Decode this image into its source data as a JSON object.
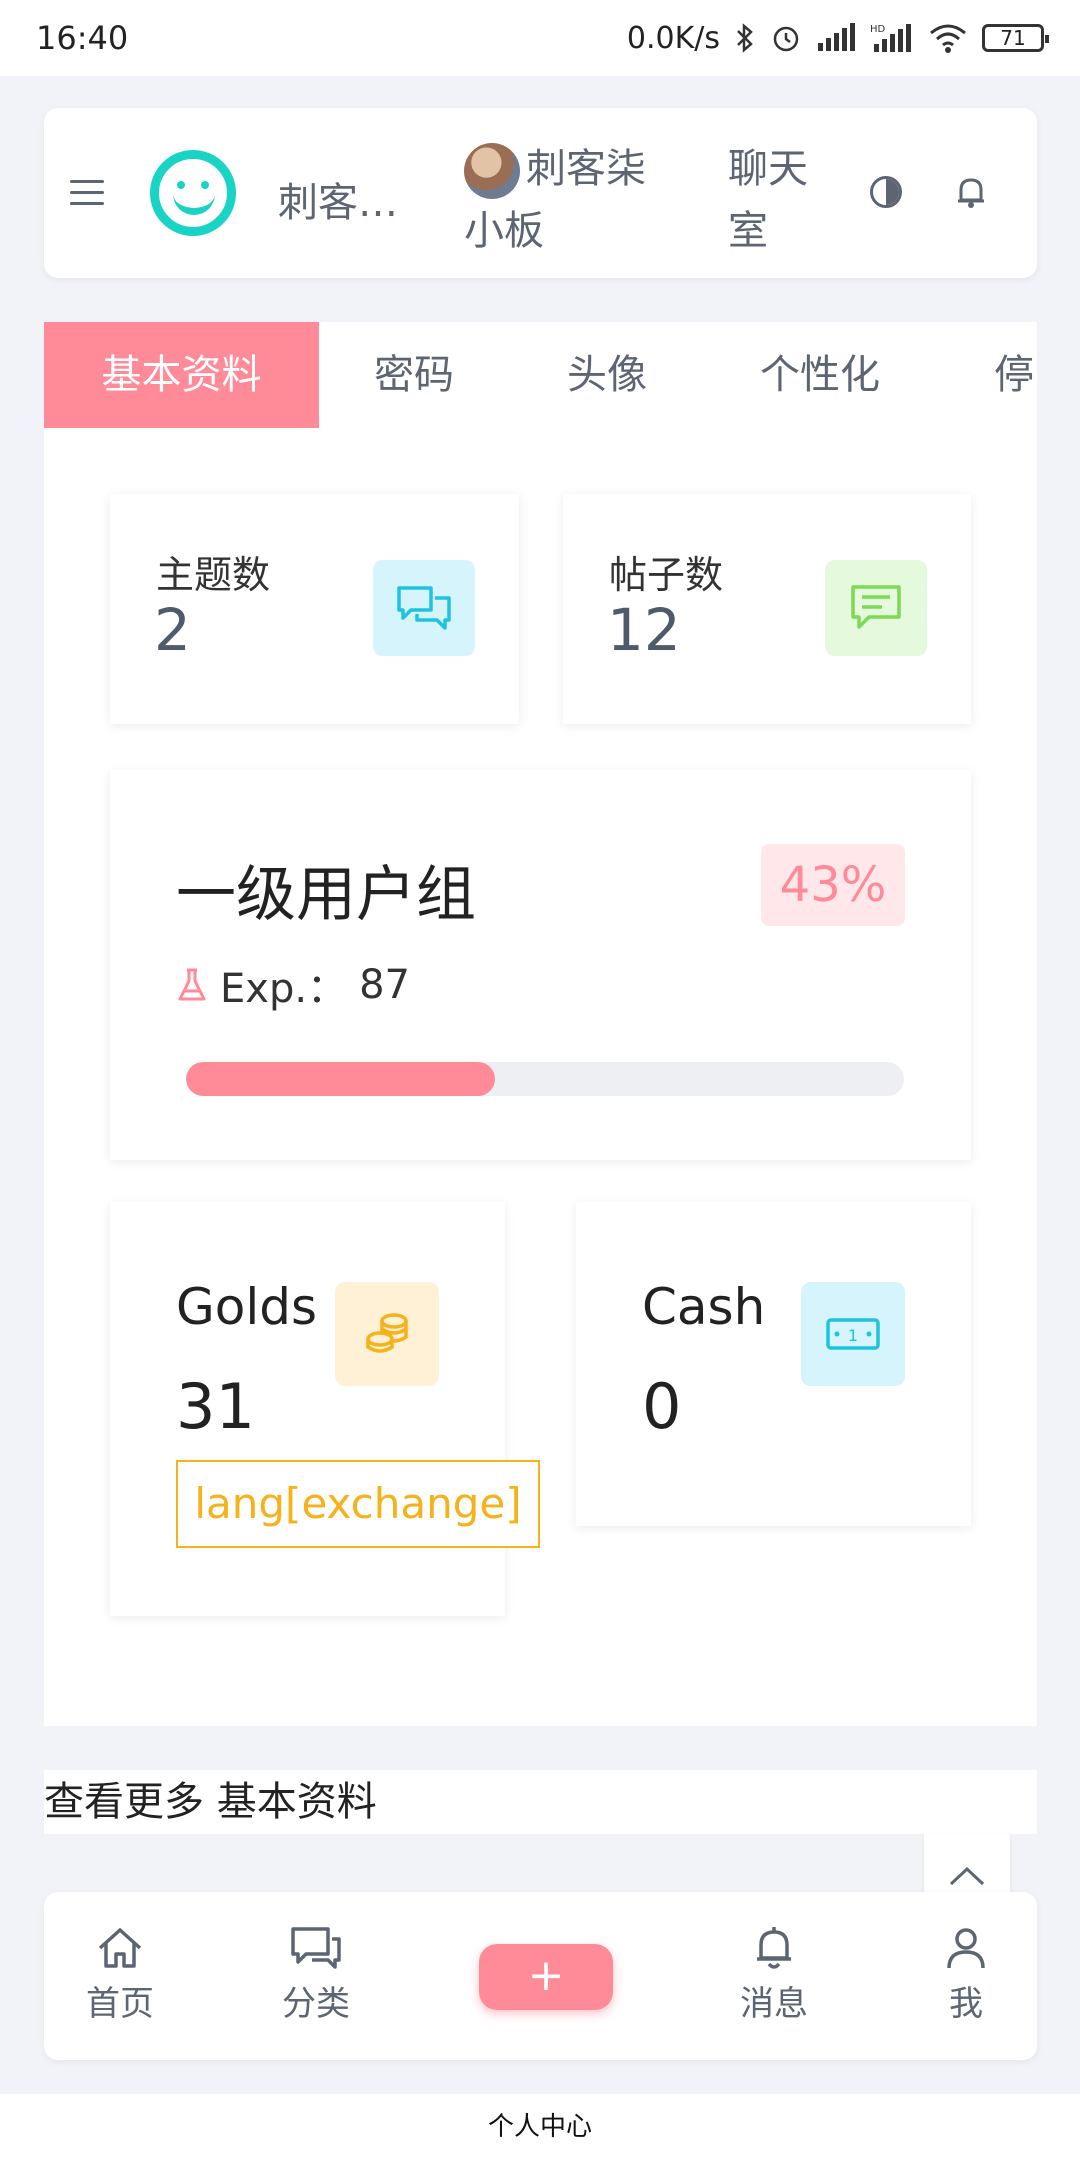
{
  "status_bar": {
    "time": "16:40",
    "speed": "0.0K/s",
    "battery": "71"
  },
  "header": {
    "site_title": "刺客…",
    "user_name": "刺客柒小板",
    "chat_label": "聊天室"
  },
  "tabs": [
    {
      "label": "基本资料",
      "active": true
    },
    {
      "label": "密码",
      "active": false
    },
    {
      "label": "头像",
      "active": false
    },
    {
      "label": "个性化",
      "active": false
    },
    {
      "label": "停",
      "active": false
    }
  ],
  "stats": {
    "topics": {
      "label": "主题数",
      "value": "2"
    },
    "posts": {
      "label": "帖子数",
      "value": "12"
    }
  },
  "level": {
    "group_name": "一级用户组",
    "percent": "43%",
    "progress_fraction": 0.43,
    "exp_label": "Exp.：",
    "exp_value": "87"
  },
  "money": {
    "golds_label": "Golds",
    "golds_value": "31",
    "exchange_label": "lang[exchange]",
    "cash_label": "Cash",
    "cash_value": "0"
  },
  "more_link": "查看更多 基本资料",
  "bottom_nav": {
    "home": "首页",
    "category": "分类",
    "add": "+",
    "messages": "消息",
    "me": "我"
  },
  "page_title": "个人中心",
  "colors": {
    "accent": "#ff8b99",
    "brand": "#19d3c5",
    "gold": "#f5b21a",
    "cyan": "#1ec3e0",
    "green": "#7ed957"
  }
}
